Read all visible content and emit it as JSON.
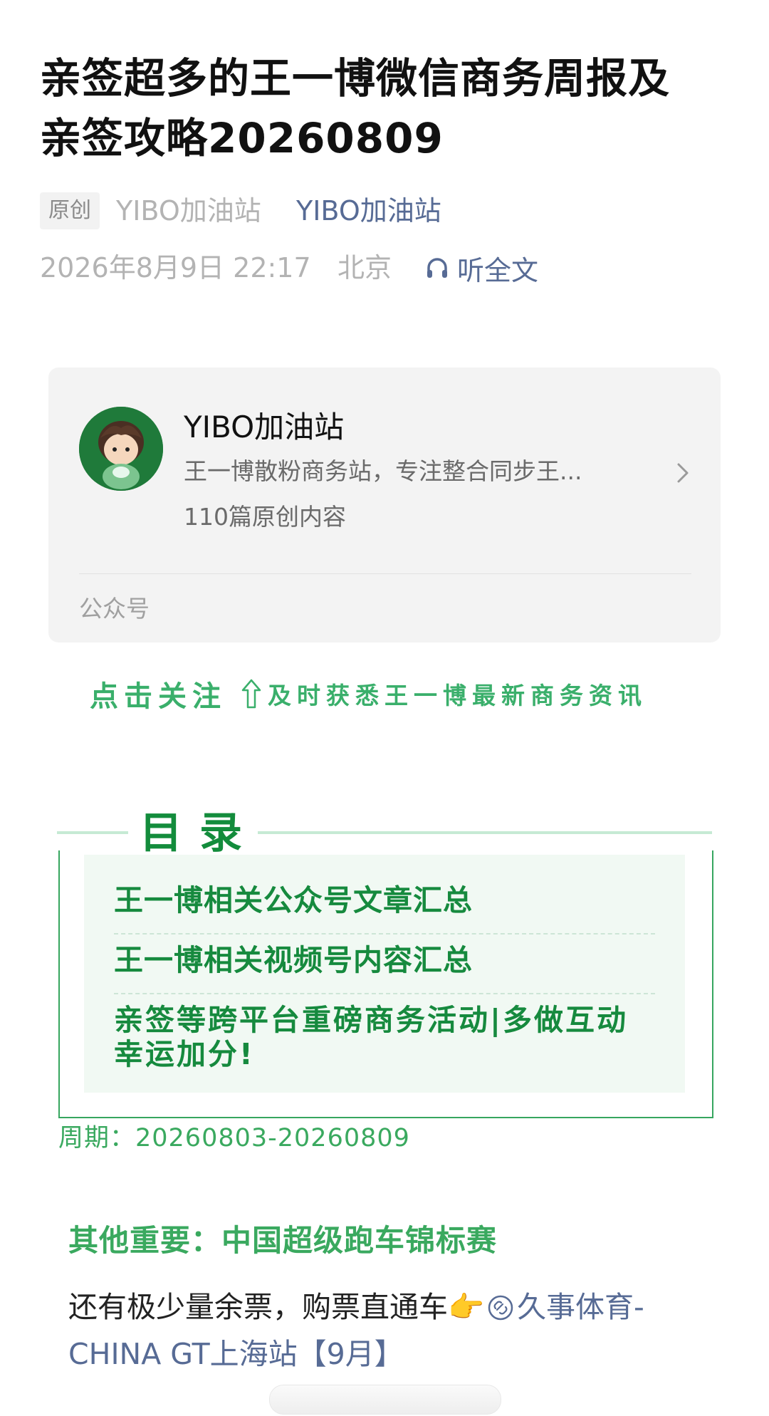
{
  "article": {
    "title": "亲签超多的王一博微信商务周报及\n亲签攻略20260809",
    "original_badge": "原创",
    "author_plain": "YIBO加油站",
    "author_link": "YIBO加油站",
    "date": "2026年8月9日 22:17",
    "location": "北京",
    "listen_label": "听全文"
  },
  "account_card": {
    "name": "YIBO加油站",
    "description": "王一博散粉商务站，专注整合同步王...",
    "count": "110篇原创内容",
    "footer": "公众号"
  },
  "follow_prompt": {
    "bold": "点击关注",
    "rest": "及时获悉王一博最新商务资讯"
  },
  "toc": {
    "title": "目录",
    "items": [
      "王一博相关公众号文章汇总",
      "王一博相关视频号内容汇总",
      "亲签等跨平台重磅商务活动|多做互动幸运加分!"
    ],
    "period": "周期：20260803-20260809"
  },
  "section": {
    "heading": "其他重要：中国超级跑车锦标赛",
    "text_before": "还有极少量余票，购票直通车",
    "emoji": "👉",
    "link_text": "久事体育-CHINA GT上海站【9月】"
  },
  "colors": {
    "link": "#576b95",
    "green_dark": "#138c3c",
    "green_light": "#3aa95f"
  }
}
